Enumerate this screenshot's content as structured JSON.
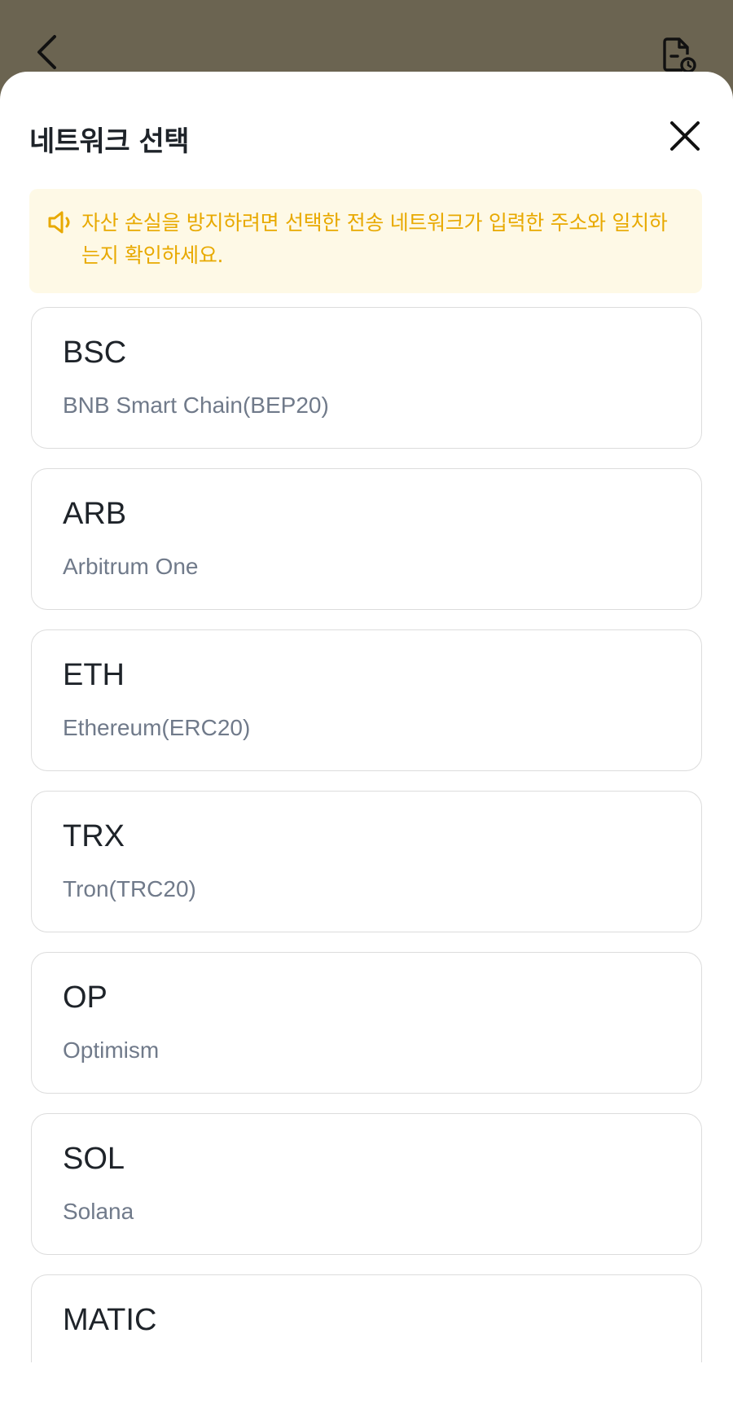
{
  "header": {
    "back_icon": "chevron-left-icon",
    "history_icon": "document-clock-icon"
  },
  "sheet": {
    "title": "네트워크 선택",
    "close_icon": "close-icon"
  },
  "warning": {
    "icon": "speaker-icon",
    "text": "자산 손실을 방지하려면 선택한 전송 네트워크가 입력한 주소와 일치하는지 확인하세요.",
    "color": "#e8a900",
    "background": "#fef9e6"
  },
  "networks": [
    {
      "code": "BSC",
      "name": "BNB Smart Chain(BEP20)"
    },
    {
      "code": "ARB",
      "name": "Arbitrum One"
    },
    {
      "code": "ETH",
      "name": "Ethereum(ERC20)"
    },
    {
      "code": "TRX",
      "name": "Tron(TRC20)"
    },
    {
      "code": "OP",
      "name": "Optimism"
    },
    {
      "code": "SOL",
      "name": "Solana"
    },
    {
      "code": "MATIC",
      "name": ""
    }
  ]
}
